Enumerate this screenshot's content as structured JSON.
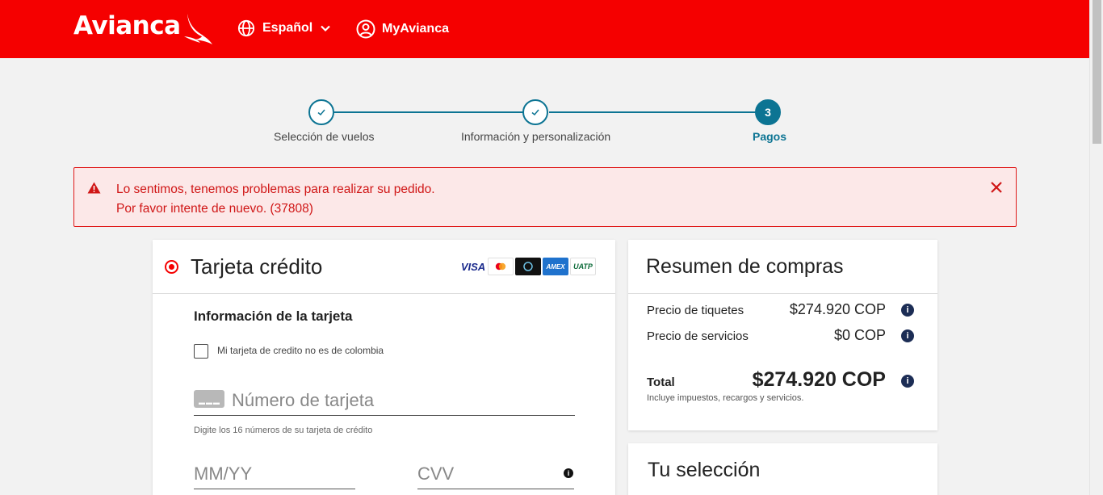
{
  "header": {
    "logo": "Avianca",
    "language_label": "Español",
    "account_label": "MyAvianca"
  },
  "stepper": {
    "steps": [
      {
        "label": "Selección de vuelos",
        "state": "done"
      },
      {
        "label": "Información y personalización",
        "state": "done"
      },
      {
        "label": "Pagos",
        "state": "active",
        "number": "3"
      }
    ]
  },
  "alert": {
    "line1": "Lo sentimos, tenemos problemas para realizar su pedido.",
    "line2": "Por favor intente de nuevo. (37808)"
  },
  "payment": {
    "method_title": "Tarjeta crédito",
    "card_brands": [
      "VISA",
      "Mastercard",
      "Diners Club",
      "AMEX",
      "UATP"
    ],
    "card_info_title": "Información de la tarjeta",
    "foreign_card_checkbox_label": "Mi tarjeta de credito no es de colombia",
    "card_number_placeholder": "Número de tarjeta",
    "card_number_hint": "Digite los 16 números de su tarjeta de crédito",
    "expiry_placeholder": "MM/YY",
    "cvv_placeholder": "CVV"
  },
  "summary": {
    "title": "Resumen de compras",
    "ticket_label": "Precio de tiquetes",
    "ticket_value": "$274.920 COP",
    "services_label": "Precio de servicios",
    "services_value": "$0 COP",
    "total_label": "Total",
    "total_value": "$274.920 COP",
    "total_note": "Incluye impuestos, recargos y servicios."
  },
  "selection": {
    "title": "Tu selección"
  },
  "colors": {
    "brand_red": "#f50000",
    "stepper_teal": "#0c7493",
    "error_red": "#d01616"
  }
}
